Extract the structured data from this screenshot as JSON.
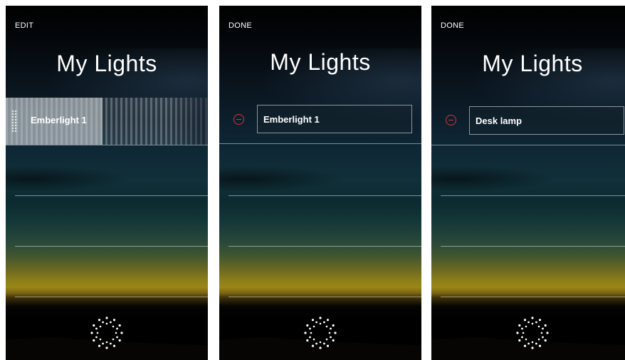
{
  "screens": [
    {
      "action_label": "EDIT",
      "title": "My Lights",
      "light_name": "Emberlight 1",
      "mode": "dragging"
    },
    {
      "action_label": "DONE",
      "title": "My Lights",
      "light_name": "Emberlight 1",
      "mode": "editing"
    },
    {
      "action_label": "DONE",
      "title": "My Lights",
      "light_name": "Desk lamp",
      "mode": "editing"
    }
  ],
  "icons": {
    "add_light": "sun-dots-icon",
    "remove_light": "minus-circle-icon",
    "reorder": "drag-handle-icon"
  },
  "colors": {
    "remove_accent": "#d8363a",
    "text": "#ffffff"
  }
}
